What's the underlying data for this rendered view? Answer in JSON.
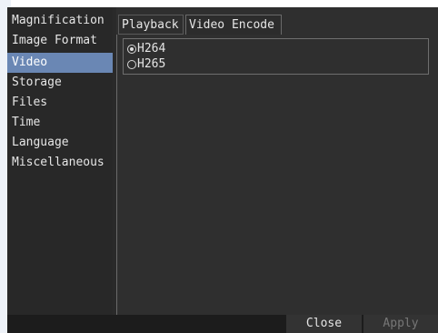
{
  "sidebar": {
    "items": [
      {
        "label": "Magnification"
      },
      {
        "label": "Image Format"
      },
      {
        "label": "Video"
      },
      {
        "label": "Storage"
      },
      {
        "label": "Files"
      },
      {
        "label": "Time"
      },
      {
        "label": "Language"
      },
      {
        "label": "Miscellaneous"
      }
    ],
    "selected": "Video"
  },
  "tabs": [
    {
      "label": "Playback"
    },
    {
      "label": "Video Encode"
    }
  ],
  "active_tab": "Video Encode",
  "codec": {
    "options": [
      {
        "label": "H264",
        "checked": true
      },
      {
        "label": "H265",
        "checked": false
      }
    ]
  },
  "footer": {
    "close_label": "Close",
    "apply_label": "Apply"
  },
  "colors": {
    "selection": "#6a87b4",
    "background": "#2f2f2f",
    "sidebar": "#282828"
  }
}
